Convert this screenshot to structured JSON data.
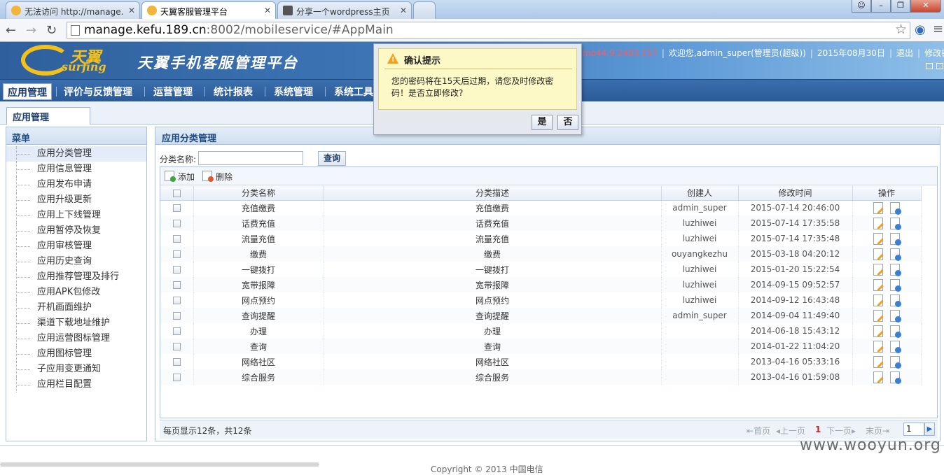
{
  "browser": {
    "tabs": [
      {
        "title": "无法访问 http://manage."
      },
      {
        "title": "天翼客服管理平台"
      },
      {
        "title": "分享一个wordpress主页"
      }
    ],
    "url_host": "manage.kefu.189.cn",
    "url_rest": ":8002/mobileservice/#AppMain"
  },
  "header": {
    "logo_cn": "天翼",
    "logo_en": "surfing",
    "app_name": "天翼手机客服管理平台",
    "ip": "mo44.9.2403.157",
    "welcome": "欢迎您,admin_super(管理员(超级))",
    "date": "2015年08月30日",
    "logout": "退出",
    "change_pwd": "修改密码"
  },
  "main_menu": [
    "应用管理",
    "评价与反馈管理",
    "运营管理",
    "统计报表",
    "系统管理",
    "系统工具"
  ],
  "sub_tab": "应用管理",
  "left_menu": {
    "title": "菜单",
    "items": [
      "应用分类管理",
      "应用信息管理",
      "应用发布申请",
      "应用升级更新",
      "应用上下线管理",
      "应用暂停及恢复",
      "应用审核管理",
      "应用历史查询",
      "应用推荐管理及排行",
      "应用APK包修改",
      "开机画面维护",
      "渠道下载地址维护",
      "应用运营图标管理",
      "应用图标管理",
      "子应用变更通知",
      "应用栏目配置"
    ]
  },
  "content": {
    "title": "应用分类管理",
    "search_label": "分类名称:",
    "search_value": "",
    "search_button": "查询",
    "add_label": "添加",
    "delete_label": "删除",
    "columns": [
      "分类名称",
      "分类描述",
      "创建人",
      "修改时间",
      "操作"
    ],
    "rows": [
      {
        "name": "充值缴费",
        "desc": "充值缴费",
        "creator": "admin_super",
        "time": "2015-07-14 20:46:00"
      },
      {
        "name": "话费充值",
        "desc": "话费充值",
        "creator": "luzhiwei",
        "time": "2015-07-14 17:35:58"
      },
      {
        "name": "流量充值",
        "desc": "流量充值",
        "creator": "luzhiwei",
        "time": "2015-07-14 17:35:48"
      },
      {
        "name": "缴费",
        "desc": "缴费",
        "creator": "ouyangkezhu",
        "time": "2015-03-18 04:20:12"
      },
      {
        "name": "一键拨打",
        "desc": "一键拨打",
        "creator": "luzhiwei",
        "time": "2015-01-20 15:22:54"
      },
      {
        "name": "宽带报障",
        "desc": "宽带报障",
        "creator": "luzhiwei",
        "time": "2014-09-15 09:52:57"
      },
      {
        "name": "网点预约",
        "desc": "网点预约",
        "creator": "luzhiwei",
        "time": "2014-09-12 16:43:48"
      },
      {
        "name": "查询提醒",
        "desc": "查询提醒",
        "creator": "admin_super",
        "time": "2014-09-04 11:49:40"
      },
      {
        "name": "办理",
        "desc": "办理",
        "creator": "",
        "time": "2014-06-18 15:43:12"
      },
      {
        "name": "查询",
        "desc": "查询",
        "creator": "",
        "time": "2014-01-22 11:04:20"
      },
      {
        "name": "网络社区",
        "desc": "网络社区",
        "creator": "",
        "time": "2013-04-16 05:33:16"
      },
      {
        "name": "综合服务",
        "desc": "综合服务",
        "creator": "",
        "time": "2013-04-16 01:59:08"
      }
    ],
    "page_summary": "每页显示12条，共12条",
    "pager": {
      "first": "首页",
      "prev": "上一页",
      "current": "1",
      "next": "下一页",
      "last": "末页",
      "input": "1"
    }
  },
  "dialog": {
    "title": "确认提示",
    "message": "您的密码将在15天后过期，请您及时修改密码！是否立即修改?",
    "yes": "是",
    "no": "否"
  },
  "footer": {
    "copyright": "Copyright © 2013 中国电信"
  },
  "watermark": "www.wooyun.org"
}
